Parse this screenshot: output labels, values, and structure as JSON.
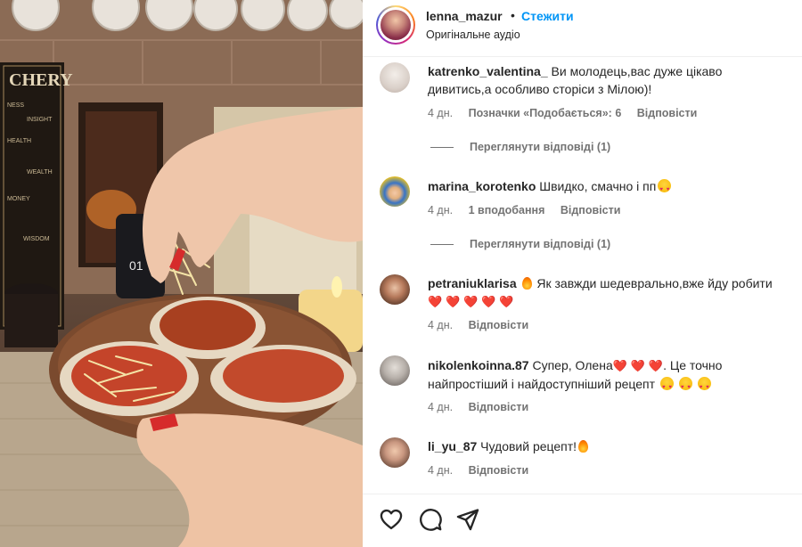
{
  "post": {
    "username": "lenna_mazur",
    "separator": "•",
    "follow_label": "Стежити",
    "audio_label": "Оригінальне аудіо"
  },
  "comments": [
    {
      "username": "katrenko_valentina_",
      "text": "Ви молодець,вас дуже цікаво дивитись,а особливо сторіси з Мілою)!",
      "time": "4 дн.",
      "likes": "Позначки «Подобається»: 6",
      "reply": "Відповісти",
      "view_replies": "Переглянути відповіді (1)"
    },
    {
      "username": "marina_korotenko",
      "text": "Швидко, смачно і пп",
      "time": "4 дн.",
      "likes": "1 вподобання",
      "reply": "Відповісти",
      "view_replies": "Переглянути відповіді (1)"
    },
    {
      "username": "petraniuklarisa",
      "text": "Як завжди шедеврально,вже йду робити",
      "time": "4 дн.",
      "reply": "Відповісти"
    },
    {
      "username": "nikolenkoinna.87",
      "text_a": "Супер, Олена",
      "text_b": ". Це точно найпростіший і найдоступніший рецепт",
      "time": "4 дн.",
      "reply": "Відповісти"
    },
    {
      "username": "li_yu_87",
      "text": "Чудовий рецепт!",
      "time": "4 дн.",
      "reply": "Відповісти"
    }
  ],
  "icons": {
    "like": "heart-outline-icon",
    "comment": "comment-bubble-icon",
    "share": "paper-plane-icon",
    "heart_emoji": "red-heart-emoji",
    "fire_emoji": "fire-emoji",
    "love_face_emoji": "heart-eyes-emoji"
  },
  "colors": {
    "follow": "#0095f6",
    "meta": "#737373",
    "text": "#262626",
    "heart": "#ed1c24"
  }
}
